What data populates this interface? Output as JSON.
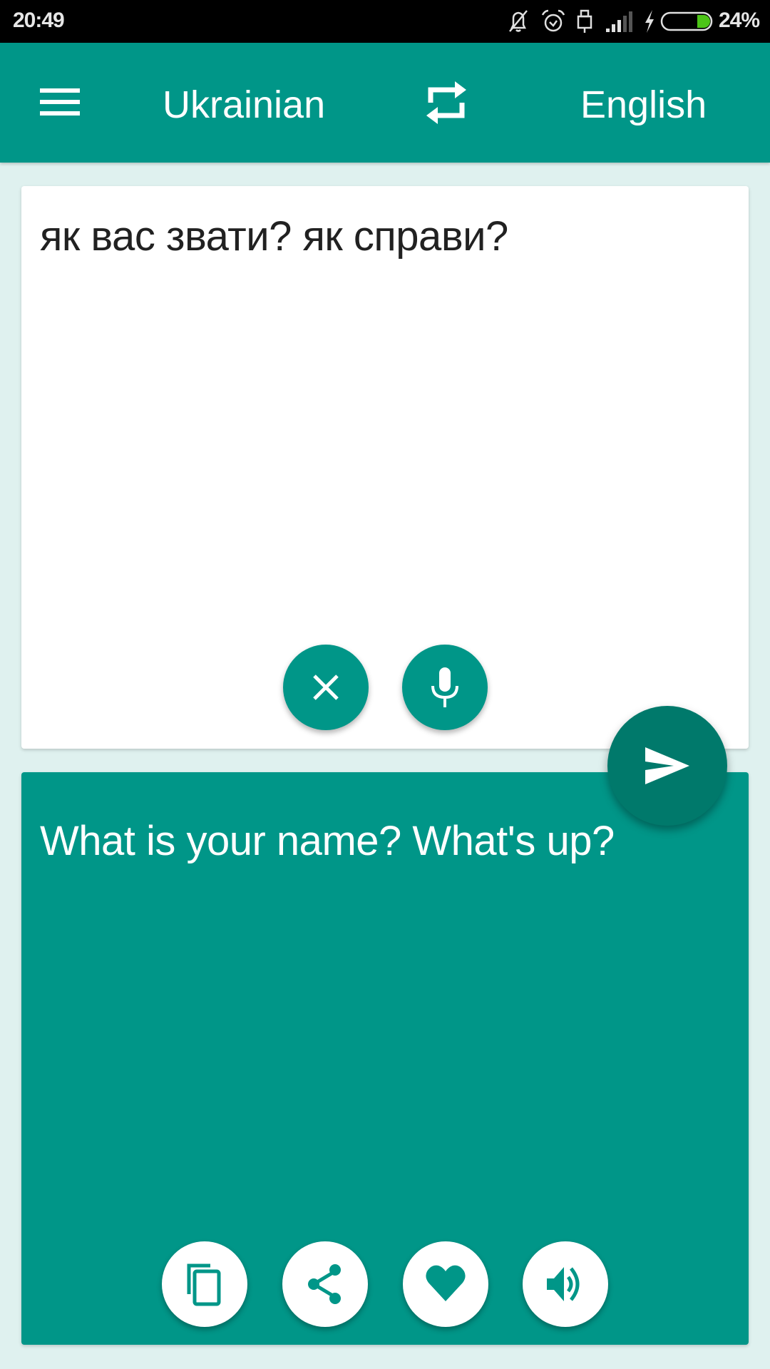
{
  "status_bar": {
    "time": "20:49",
    "battery_percent": "24%",
    "battery_level": 0.24,
    "icons": [
      "notifications-off-icon",
      "alarm-icon",
      "usb-icon",
      "signal-icon",
      "charging-icon",
      "battery-icon"
    ]
  },
  "app_bar": {
    "menu_icon": "hamburger-menu-icon",
    "source_language": "Ukrainian",
    "swap_icon": "swap-languages-icon",
    "target_language": "English"
  },
  "input": {
    "text": "як вас звати? як справи?",
    "clear_icon": "close-icon",
    "mic_icon": "microphone-icon"
  },
  "translate_button": {
    "icon": "send-icon"
  },
  "output": {
    "text": "What is your name? What's up?",
    "actions": [
      {
        "name": "copy",
        "icon": "copy-icon"
      },
      {
        "name": "share",
        "icon": "share-icon"
      },
      {
        "name": "favorite",
        "icon": "heart-icon"
      },
      {
        "name": "speak",
        "icon": "speaker-icon"
      }
    ]
  },
  "colors": {
    "primary": "#009688",
    "primary_dark": "#00796B",
    "background": "#DFF1EF",
    "battery_fill": "#4CC417"
  }
}
